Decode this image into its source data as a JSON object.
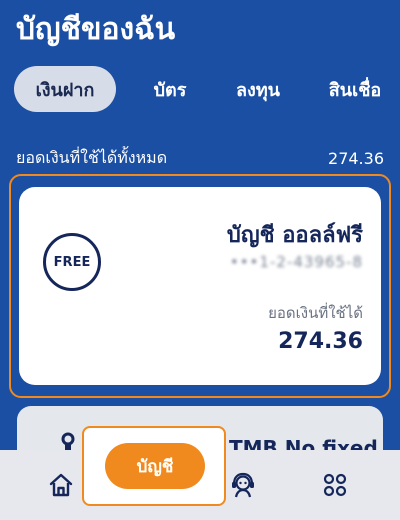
{
  "header": {
    "title": "บัญชีของฉัน"
  },
  "tabs": [
    {
      "label": "เงินฝาก",
      "active": true
    },
    {
      "label": "บัตร",
      "active": false
    },
    {
      "label": "ลงทุน",
      "active": false
    },
    {
      "label": "สินเชื่อ",
      "active": false
    }
  ],
  "summary": {
    "label": "ยอดเงินที่ใช้ได้ทั้งหมด",
    "value": "274.36"
  },
  "account_card": {
    "badge": "FREE",
    "name": "บัญชี ออลล์ฟรี",
    "number_masked": "•••1-2-43965-8",
    "available_label": "ยอดเงินที่ใช้ได้",
    "available_value": "274.36"
  },
  "next_card": {
    "title": "TMB No fixed",
    "icon": "piggy-bank-icon"
  },
  "bottom_nav": {
    "home_icon": "home-icon",
    "active_label": "บัญชี",
    "support_icon": "support-agent-icon",
    "more_icon": "apps-grid-icon"
  },
  "colors": {
    "background": "#1a4fa3",
    "accent": "#f08a1e",
    "navy_text": "#15265a",
    "active_tab_bg": "#d6dde8"
  }
}
